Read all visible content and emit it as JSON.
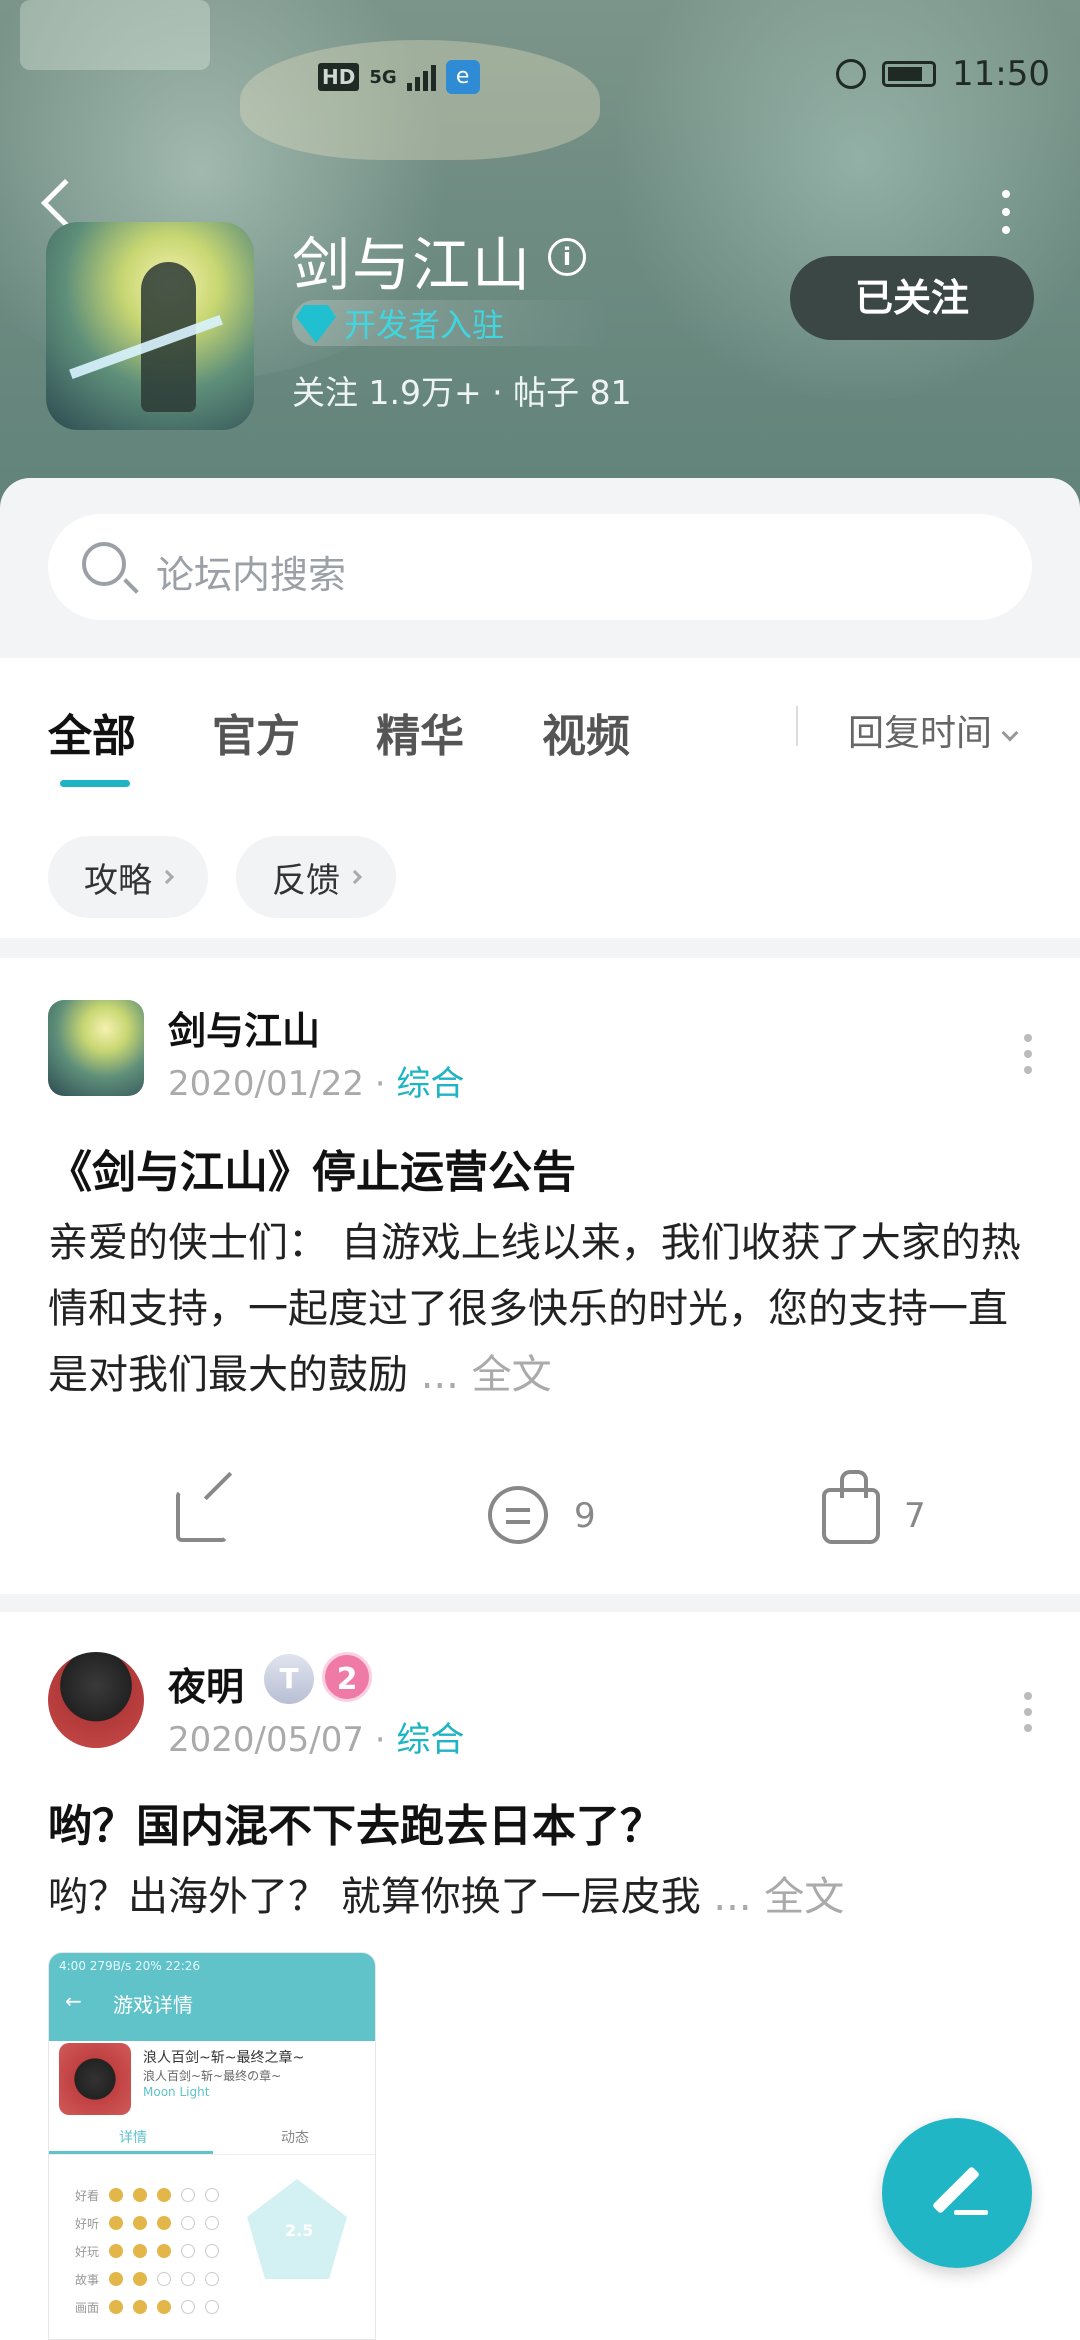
{
  "status_bar": {
    "network": "HD",
    "signal": "5G",
    "time": "11:50"
  },
  "header": {
    "game_title": "剑与江山",
    "developer_badge": "开发者入驻",
    "stats": "关注 1.9万+ · 帖子 81",
    "follow_label": "已关注"
  },
  "search": {
    "placeholder": "论坛内搜索"
  },
  "tabs": [
    {
      "label": "全部",
      "active": true
    },
    {
      "label": "官方",
      "active": false
    },
    {
      "label": "精华",
      "active": false
    },
    {
      "label": "视频",
      "active": false
    }
  ],
  "sort_label": "回复时间",
  "chips": [
    "攻略",
    "反馈"
  ],
  "posts": [
    {
      "author": "剑与江山",
      "date": "2020/01/22",
      "category": "综合",
      "title": "《剑与江山》停止运营公告",
      "body": "亲爱的侠士们： 自游戏上线以来，我们收获了大家的热情和支持，一起度过了很多快乐的时光，您的支持一直是对我们最大的鼓励",
      "ellipsis": " ... ",
      "full_text": "全文",
      "comments": "9",
      "likes": "7"
    },
    {
      "author": "夜明",
      "badge_t": "T",
      "badge_level": "2",
      "date": "2020/05/07",
      "category": "综合",
      "title": "哟？国内混不下去跑去日本了？",
      "body": "哟？出海外了？ 就算你换了一层皮我",
      "ellipsis": " ... ",
      "full_text": "全文"
    }
  ],
  "embedded_screenshot": {
    "status": "4:00 279B/s 20% 22:26",
    "title": "游戏详情",
    "game_name": "浪人百剑~斩~最终之章~",
    "game_sub": "浪人百剑~斩~最终の章~",
    "game_en": "Moon Light",
    "tab_detail": "详情",
    "tab_feed": "动态",
    "rows": [
      "好看",
      "好听",
      "好玩",
      "故事",
      "画面"
    ],
    "score": "2.5"
  }
}
